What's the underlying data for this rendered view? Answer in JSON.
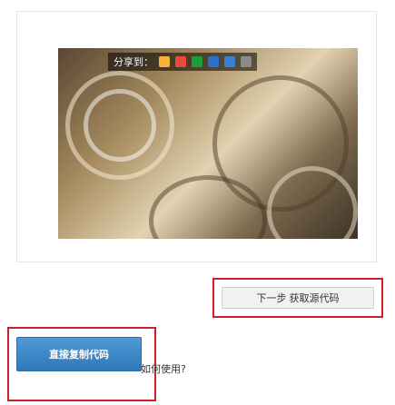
{
  "preview": {
    "share_label": "分享到：",
    "share_icons": [
      {
        "name": "qzone-icon",
        "color": "#f6b53a"
      },
      {
        "name": "weibo-icon",
        "color": "#e84a3b"
      },
      {
        "name": "douban-icon",
        "color": "#1e9d3b"
      },
      {
        "name": "renren-icon",
        "color": "#2c6ecb"
      },
      {
        "name": "tieba-icon",
        "color": "#3a7fd1"
      },
      {
        "name": "more-icon",
        "color": "#8a8a8a"
      }
    ]
  },
  "next_step": {
    "label": "下一步 获取源代码"
  },
  "copy": {
    "button_label": "直接复制代码",
    "help_link": "如何使用?"
  },
  "colors": {
    "highlight_border": "#d01f24",
    "primary_button": "#3f8ad0"
  }
}
